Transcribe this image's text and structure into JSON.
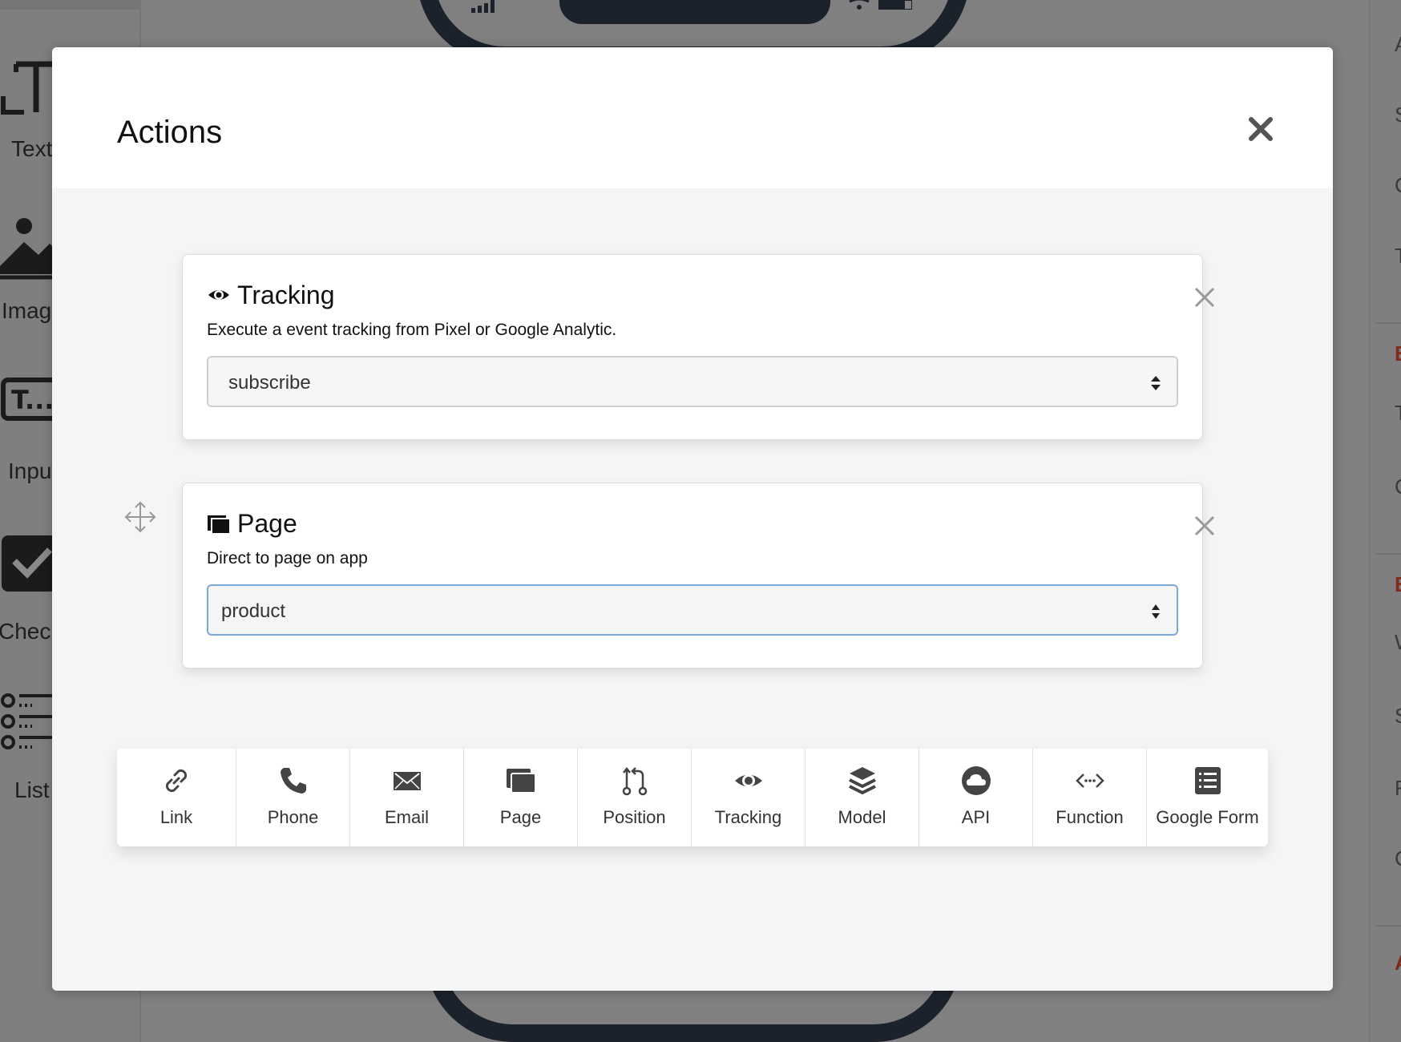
{
  "background": {
    "left_tools": [
      {
        "label": "Text",
        "icon": "text-icon"
      },
      {
        "label": "Image",
        "icon": "image-icon"
      },
      {
        "label": "Input",
        "icon": "input-icon"
      },
      {
        "label": "Checkbox",
        "icon": "checkbox-icon"
      },
      {
        "label": "List",
        "icon": "list-icon"
      }
    ],
    "right_labels": [
      "A",
      "S",
      "C",
      "T",
      "B",
      "T",
      "C",
      "B",
      "W",
      "S",
      "F",
      "C",
      "A"
    ]
  },
  "modal": {
    "title": "Actions",
    "close_icon": "close-icon"
  },
  "actions": [
    {
      "title": "Tracking",
      "icon": "eye-icon",
      "description": "Execute a event tracking from Pixel or Google Analytic.",
      "selected": "subscribe"
    },
    {
      "title": "Page",
      "icon": "pages-icon",
      "description": "Direct to page on app",
      "selected": "product"
    }
  ],
  "action_bar": [
    {
      "label": "Link",
      "icon": "link-icon"
    },
    {
      "label": "Phone",
      "icon": "phone-icon"
    },
    {
      "label": "Email",
      "icon": "envelope-icon"
    },
    {
      "label": "Page",
      "icon": "pages-icon"
    },
    {
      "label": "Position",
      "icon": "position-icon"
    },
    {
      "label": "Tracking",
      "icon": "eye-icon"
    },
    {
      "label": "Model",
      "icon": "layers-icon"
    },
    {
      "label": "API",
      "icon": "cloud-icon"
    },
    {
      "label": "Function",
      "icon": "code-icon"
    },
    {
      "label": "Google Form",
      "icon": "form-list-icon"
    }
  ],
  "colors": {
    "overlay": "#808080",
    "modal_bg": "#f4f5f7",
    "focus_border": "#7aa7de",
    "right_panel_accent": "#7e2a1c"
  }
}
